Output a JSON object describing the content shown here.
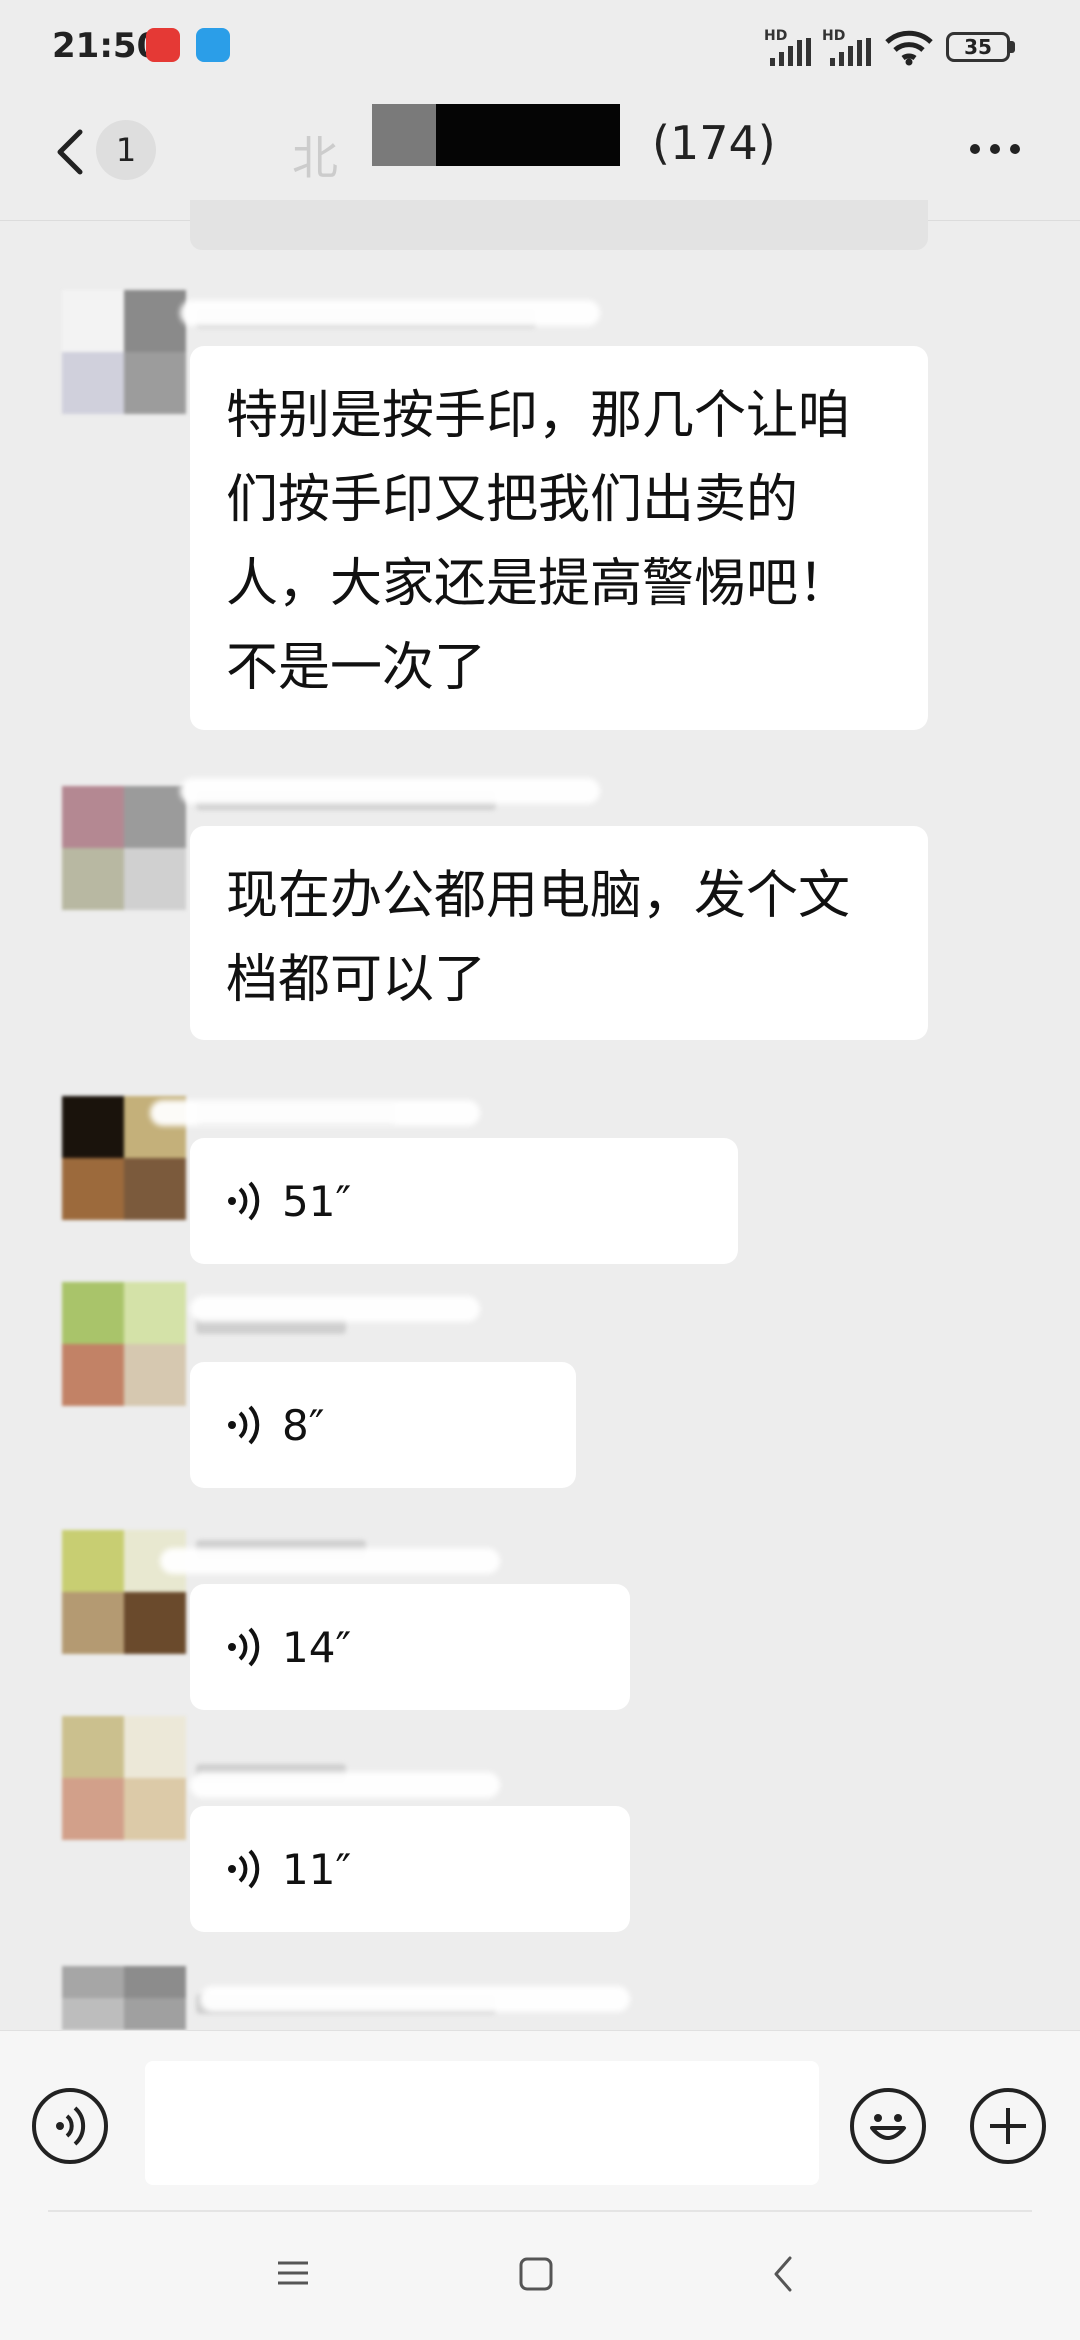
{
  "status_bar": {
    "time": "21:50",
    "hd_label": "HD",
    "battery": "35"
  },
  "header": {
    "unread_count": "1",
    "title_prefix": "北",
    "member_count": "(174)"
  },
  "messages": [
    {
      "type": "text",
      "text_lines": [
        "特别是按手印，那几个让咱",
        "们按手印又把我们出卖的",
        "人，大家还是提高警惕吧！",
        "不是一次了"
      ]
    },
    {
      "type": "text",
      "text_lines": [
        "现在办公都用电脑，发个文",
        "档都可以了"
      ]
    },
    {
      "type": "voice",
      "duration": "51″"
    },
    {
      "type": "voice",
      "duration": "8″"
    },
    {
      "type": "voice",
      "duration": "14″"
    },
    {
      "type": "voice",
      "duration": "11″"
    }
  ],
  "icons": {
    "back": "chevron-left-icon",
    "more": "more-dots-icon",
    "voice_input": "voice-icon",
    "emoji": "emoji-icon",
    "add": "plus-icon",
    "menu": "menu-icon",
    "home": "home-icon",
    "system_back": "back-icon"
  },
  "colors": {
    "background": "#ededed",
    "bubble": "#ffffff",
    "input_bar": "#f6f6f6"
  }
}
